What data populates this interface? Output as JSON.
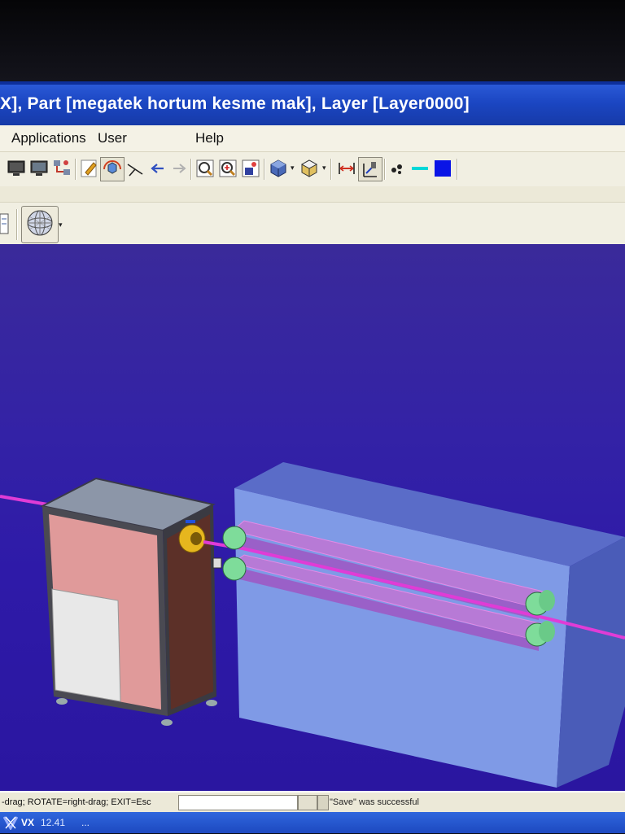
{
  "window": {
    "title": "X], Part [megatek hortum kesme mak], Layer [Layer0000]"
  },
  "menu": {
    "items": [
      "Applications",
      "User",
      "Help"
    ]
  },
  "toolbar": {
    "icons": [
      "monitor-icon",
      "monitor-shaded-icon",
      "network-icon",
      "edit-pencil-icon",
      "rotate-view-icon",
      "axis-icon",
      "arrow-left-icon",
      "arrow-right-icon",
      "zoom-fit-icon",
      "zoom-in-icon",
      "view-box-icon",
      "cube-shaded-icon",
      "cube-section-icon",
      "dimension-icon",
      "measure-icon",
      "points-icon",
      "line-color-icon",
      "fill-color-icon"
    ],
    "line_color": "#00d8d8",
    "fill_color": "#0a14e6"
  },
  "toolbar2": {
    "icons": [
      "page-icon",
      "sphere-mesh-icon"
    ]
  },
  "viewport": {
    "background": "#2e1aa8",
    "model_colors": {
      "cabinet_front": "#e09a9a",
      "cabinet_panel": "#e8e8e8",
      "cabinet_side": "#5c3028",
      "block": "#7f9ae6",
      "belt": "#b77ad6",
      "roller": "#7edc9a",
      "hose": "#e03cd6",
      "nozzle": "#e6b61e"
    }
  },
  "status": {
    "hint": "-drag; ROTATE=right-drag; EXIT=Esc",
    "input_value": "",
    "message": "\"Save\" was successful"
  },
  "taskbar": {
    "app": "VX",
    "version": "12.41",
    "more": "..."
  }
}
